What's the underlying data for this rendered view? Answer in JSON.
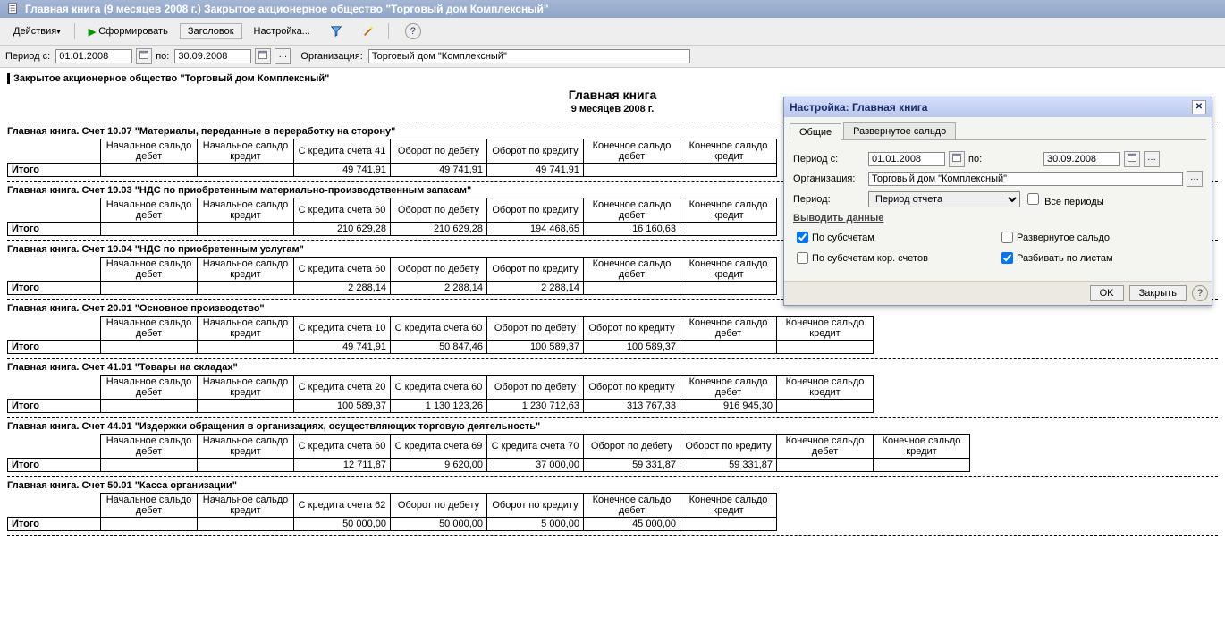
{
  "window": {
    "title": "Главная книга (9 месяцев 2008 г.) Закрытое акционерное общество \"Торговый дом Комплексный\""
  },
  "toolbar": {
    "actions": "Действия",
    "form": "Сформировать",
    "header": "Заголовок",
    "settings": "Настройка...",
    "help": "?"
  },
  "filters": {
    "period_from_label": "Период с:",
    "period_from": "01.01.2008",
    "period_to_label": "по:",
    "period_to": "30.09.2008",
    "org_label": "Организация:",
    "org_value": "Торговый дом \"Комплексный\""
  },
  "report": {
    "company": "Закрытое акционерное общество \"Торговый дом Комплексный\"",
    "title": "Главная книга",
    "subtitle": "9 месяцев 2008 г.",
    "total_label": "Итого"
  },
  "sections": [
    {
      "head": "Главная книга. Счет 10.07 \"Материалы, переданные в переработку на сторону\"",
      "cols": [
        "Начальное сальдо дебет",
        "Начальное сальдо кредит",
        "С кредита счета 41",
        "Оборот по дебету",
        "Оборот по кредиту",
        "Конечное сальдо дебет",
        "Конечное сальдо кредит"
      ],
      "totals": [
        "",
        "",
        "49 741,91",
        "49 741,91",
        "49 741,91",
        "",
        ""
      ]
    },
    {
      "head": "Главная книга. Счет 19.03 \"НДС по приобретенным материально-производственным запасам\"",
      "cols": [
        "Начальное сальдо дебет",
        "Начальное сальдо кредит",
        "С кредита счета 60",
        "Оборот по дебету",
        "Оборот по кредиту",
        "Конечное сальдо дебет",
        "Конечное сальдо кредит"
      ],
      "totals": [
        "",
        "",
        "210 629,28",
        "210 629,28",
        "194 468,65",
        "16 160,63",
        ""
      ]
    },
    {
      "head": "Главная книга. Счет 19.04 \"НДС по приобретенным услугам\"",
      "cols": [
        "Начальное сальдо дебет",
        "Начальное сальдо кредит",
        "С кредита счета 60",
        "Оборот по дебету",
        "Оборот по кредиту",
        "Конечное сальдо дебет",
        "Конечное сальдо кредит"
      ],
      "totals": [
        "",
        "",
        "2 288,14",
        "2 288,14",
        "2 288,14",
        "",
        ""
      ]
    },
    {
      "head": "Главная книга. Счет 20.01 \"Основное производство\"",
      "cols": [
        "Начальное сальдо дебет",
        "Начальное сальдо кредит",
        "С кредита счета 10",
        "С кредита счета 60",
        "Оборот по дебету",
        "Оборот по кредиту",
        "Конечное сальдо дебет",
        "Конечное сальдо кредит"
      ],
      "totals": [
        "",
        "",
        "49 741,91",
        "50 847,46",
        "100 589,37",
        "100 589,37",
        "",
        ""
      ]
    },
    {
      "head": "Главная книга. Счет 41.01 \"Товары на складах\"",
      "cols": [
        "Начальное сальдо дебет",
        "Начальное сальдо кредит",
        "С кредита счета 20",
        "С кредита счета 60",
        "Оборот по дебету",
        "Оборот по кредиту",
        "Конечное сальдо дебет",
        "Конечное сальдо кредит"
      ],
      "totals": [
        "",
        "",
        "100 589,37",
        "1 130 123,26",
        "1 230 712,63",
        "313 767,33",
        "916 945,30",
        ""
      ]
    },
    {
      "head": "Главная книга. Счет 44.01 \"Издержки обращения в организациях, осуществляющих торговую деятельность\"",
      "cols": [
        "Начальное сальдо дебет",
        "Начальное сальдо кредит",
        "С кредита счета 60",
        "С кредита счета 69",
        "С кредита счета 70",
        "Оборот по дебету",
        "Оборот по кредиту",
        "Конечное сальдо дебет",
        "Конечное сальдо кредит"
      ],
      "totals": [
        "",
        "",
        "12 711,87",
        "9 620,00",
        "37 000,00",
        "59 331,87",
        "59 331,87",
        "",
        ""
      ]
    },
    {
      "head": "Главная книга. Счет 50.01 \"Касса организации\"",
      "cols": [
        "Начальное сальдо дебет",
        "Начальное сальдо кредит",
        "С кредита счета 62",
        "Оборот по дебету",
        "Оборот по кредиту",
        "Конечное сальдо дебет",
        "Конечное сальдо кредит"
      ],
      "totals": [
        "",
        "",
        "50 000,00",
        "50 000,00",
        "5 000,00",
        "45 000,00",
        ""
      ]
    }
  ],
  "dlg": {
    "title": "Настройка: Главная книга",
    "tab_general": "Общие",
    "tab_expanded": "Развернутое сальдо",
    "period_from_label": "Период с:",
    "period_from": "01.01.2008",
    "period_to_label": "по:",
    "period_to": "30.09.2008",
    "org_label": "Организация:",
    "org_value": "Торговый дом \"Комплексный\"",
    "period_label": "Период:",
    "period_value": "Период отчета",
    "all_periods": "Все периоды",
    "output_data": "Выводить данные",
    "by_subaccounts": "По субсчетам",
    "expanded_balance": "Развернутое сальдо",
    "by_subaccounts_corr": "По субсчетам кор. счетов",
    "split_sheets": "Разбивать по листам",
    "ok": "OK",
    "close": "Закрыть",
    "help": "?"
  }
}
